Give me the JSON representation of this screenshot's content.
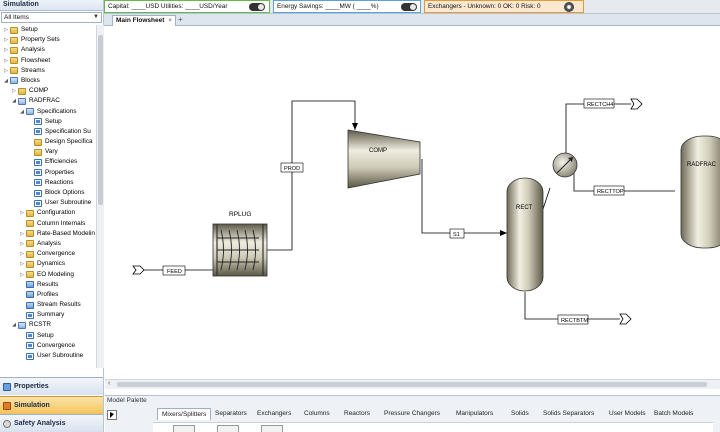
{
  "nav": {
    "header": "Simulation",
    "filter": "All Items",
    "tree": [
      {
        "label": "Setup",
        "depth": 0,
        "icon": "folder",
        "expander": "closed"
      },
      {
        "label": "Property Sets",
        "depth": 0,
        "icon": "folder",
        "expander": "closed"
      },
      {
        "label": "Analysis",
        "depth": 0,
        "icon": "folder",
        "expander": "closed"
      },
      {
        "label": "Flowsheet",
        "depth": 0,
        "icon": "folder",
        "expander": "closed"
      },
      {
        "label": "Streams",
        "depth": 0,
        "icon": "folder",
        "expander": "closed"
      },
      {
        "label": "Blocks",
        "depth": 0,
        "icon": "folderblue",
        "expander": "open"
      },
      {
        "label": "COMP",
        "depth": 1,
        "icon": "folder",
        "expander": "closed"
      },
      {
        "label": "RADFRAC",
        "depth": 1,
        "icon": "folderblue",
        "expander": "open"
      },
      {
        "label": "Specifications",
        "depth": 2,
        "icon": "folderblue",
        "expander": "open"
      },
      {
        "label": "Setup",
        "depth": 3,
        "icon": "form",
        "expander": ""
      },
      {
        "label": "Specification Su",
        "depth": 3,
        "icon": "form",
        "expander": ""
      },
      {
        "label": "Design Specifica",
        "depth": 3,
        "icon": "folder",
        "expander": ""
      },
      {
        "label": "Vary",
        "depth": 3,
        "icon": "folder",
        "expander": ""
      },
      {
        "label": "Efficiencies",
        "depth": 3,
        "icon": "form",
        "expander": ""
      },
      {
        "label": "Properties",
        "depth": 3,
        "icon": "form",
        "expander": ""
      },
      {
        "label": "Reactions",
        "depth": 3,
        "icon": "form",
        "expander": ""
      },
      {
        "label": "Block Options",
        "depth": 3,
        "icon": "form",
        "expander": ""
      },
      {
        "label": "User Subroutine",
        "depth": 3,
        "icon": "form",
        "expander": ""
      },
      {
        "label": "Configuration",
        "depth": 2,
        "icon": "folder",
        "expander": "closed"
      },
      {
        "label": "Column Internals",
        "depth": 2,
        "icon": "folder",
        "expander": ""
      },
      {
        "label": "Rate-Based Modelin",
        "depth": 2,
        "icon": "folder",
        "expander": "closed"
      },
      {
        "label": "Analysis",
        "depth": 2,
        "icon": "folder",
        "expander": "closed"
      },
      {
        "label": "Convergence",
        "depth": 2,
        "icon": "folder",
        "expander": "closed"
      },
      {
        "label": "Dynamics",
        "depth": 2,
        "icon": "folder",
        "expander": "closed"
      },
      {
        "label": "EO Modeling",
        "depth": 2,
        "icon": "folder",
        "expander": "closed"
      },
      {
        "label": "Results",
        "depth": 2,
        "icon": "blue",
        "expander": ""
      },
      {
        "label": "Profiles",
        "depth": 2,
        "icon": "blue",
        "expander": ""
      },
      {
        "label": "Stream Results",
        "depth": 2,
        "icon": "blue",
        "expander": ""
      },
      {
        "label": "Summary",
        "depth": 2,
        "icon": "form",
        "expander": ""
      },
      {
        "label": "RCSTR",
        "depth": 1,
        "icon": "folderblue",
        "expander": "open"
      },
      {
        "label": "Setup",
        "depth": 2,
        "icon": "form",
        "expander": ""
      },
      {
        "label": "Convergence",
        "depth": 2,
        "icon": "form",
        "expander": ""
      },
      {
        "label": "User Subroutine",
        "depth": 2,
        "icon": "form",
        "expander": ""
      }
    ],
    "buttons": {
      "properties": "Properties",
      "simulation": "Simulation",
      "safety": "Safety Analysis"
    }
  },
  "status": {
    "cost": "Capital: ____USD  Utilities: ____USD/Year",
    "energy": "Energy Savings: ____MW  ( ____%)",
    "exchangers": "Exchangers - Unknown: 0  OK: 0  Risk: 0"
  },
  "tabs": {
    "main": "Main Flowsheet",
    "close": "×",
    "add": "+"
  },
  "flowsheet": {
    "blocks": {
      "rplug": "RPLUG",
      "comp": "COMP",
      "rect": "RECT",
      "radfrac": "RADFRAC"
    },
    "streams": {
      "feed": "FEED",
      "prod": "PROD",
      "s1": "S1",
      "rectch4": "RECTCH4",
      "recttop": "RECTTOP",
      "rectbtm": "RECTBTM"
    }
  },
  "palette": {
    "title": "Model Palette",
    "tabs": [
      "Mixers/Splitters",
      "Separators",
      "Exchangers",
      "Columns",
      "Reactors",
      "Pressure Changers",
      "Manipulators",
      "Solids",
      "Solids Separators",
      "User Models",
      "Batch Models"
    ]
  },
  "colors": {
    "accent_selected": "#f4c35a",
    "cost_border": "#67b84f",
    "energy_border": "#5aa3d8",
    "exchanger_border": "#e39a3c"
  }
}
